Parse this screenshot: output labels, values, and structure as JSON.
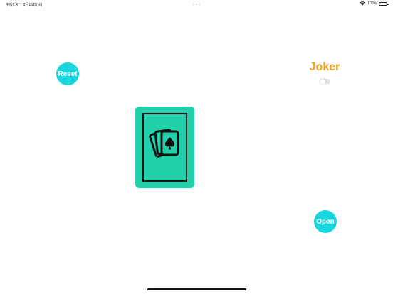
{
  "status_bar": {
    "time": "午後2:47",
    "date": "2月15日(火)",
    "battery_text": "100%",
    "battery_level": 1.0
  },
  "controls": {
    "reset_label": "Reset",
    "open_label": "Open",
    "joker_label": "Joker",
    "joker_toggle_on": false
  },
  "colors": {
    "button": "#17d6dc",
    "joker_text": "#f0a020",
    "card_back": "#22d1ac"
  },
  "card": {
    "face": "back",
    "icon": "playing-cards-spade-icon"
  }
}
